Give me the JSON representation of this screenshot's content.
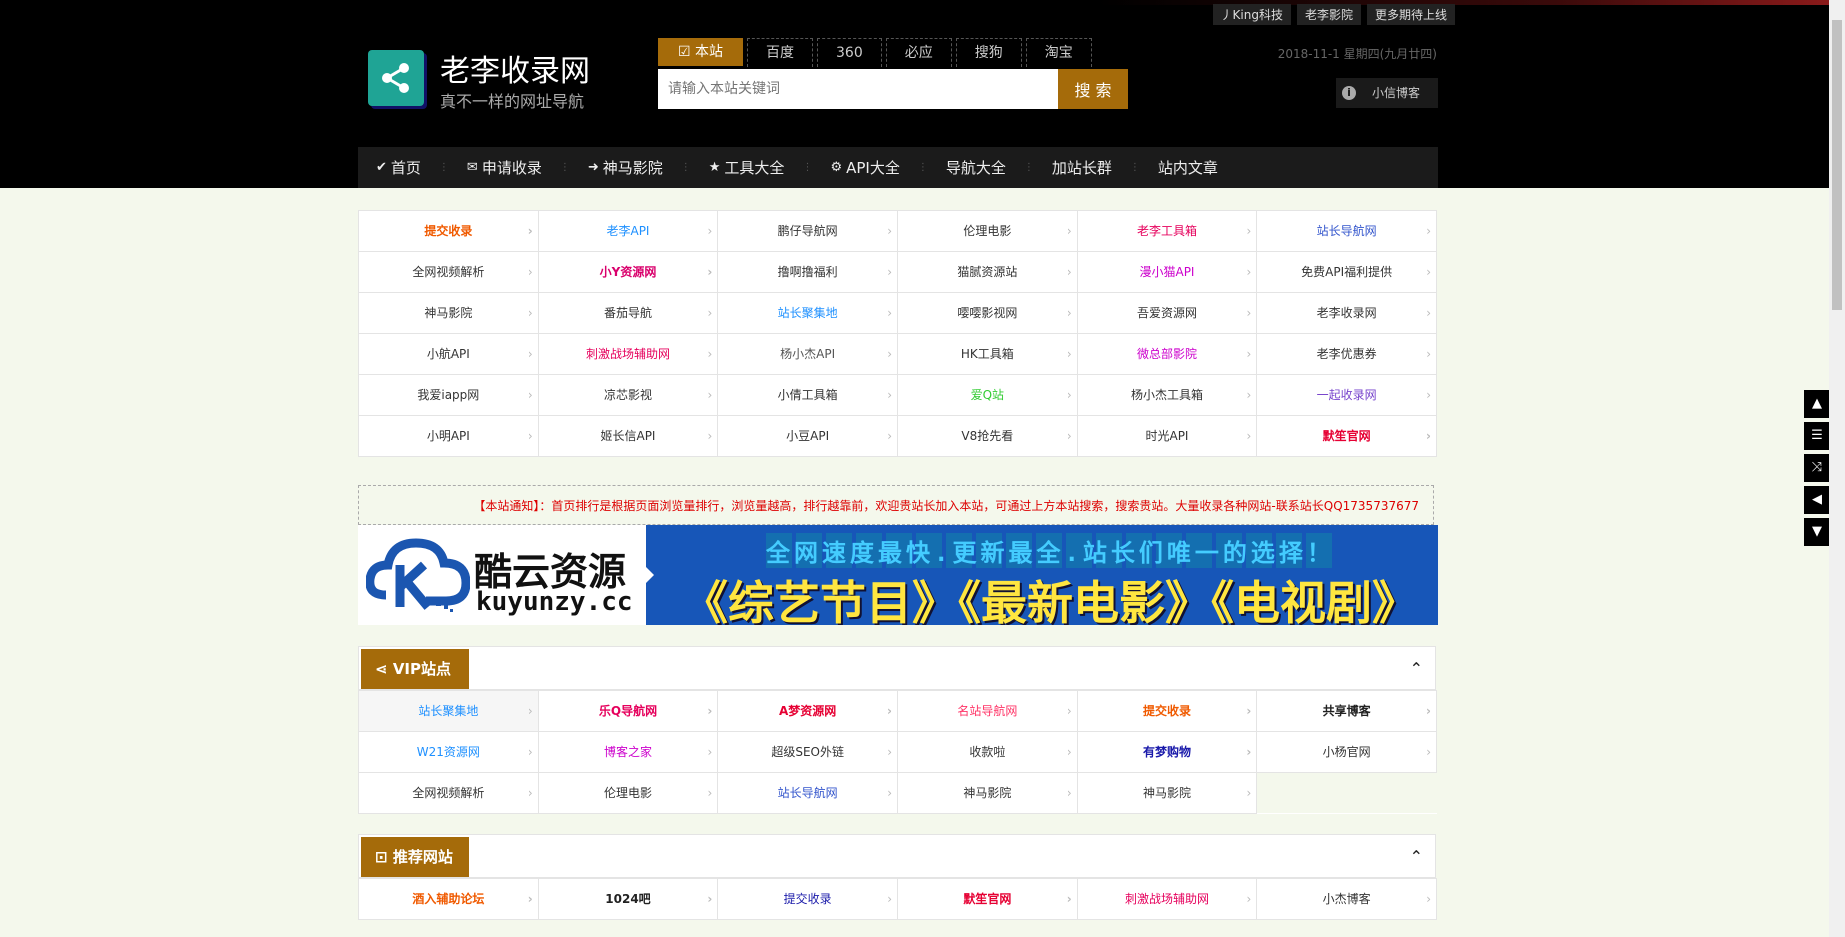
{
  "toplinks": [
    "丿King科技",
    "老李影院",
    "更多期待上线"
  ],
  "site": {
    "title": "老李收录网",
    "subtitle": "真不一样的网址导航"
  },
  "search": {
    "tabs": [
      "本站",
      "百度",
      "360",
      "必应",
      "搜狗",
      "淘宝"
    ],
    "placeholder": "请输入本站关键词",
    "button": "搜 索"
  },
  "datetime": "2018-11-1 星期四(九月廿四)",
  "user": {
    "label": "小信博客"
  },
  "nav": [
    {
      "label": "首页",
      "icon": "check-circle-icon"
    },
    {
      "label": "申请收录",
      "icon": "envelope-icon"
    },
    {
      "label": "神马影院",
      "icon": "chevron-circle-icon"
    },
    {
      "label": "工具大全",
      "icon": "star-icon"
    },
    {
      "label": "API大全",
      "icon": "gear-icon"
    },
    {
      "label": "导航大全",
      "icon": ""
    },
    {
      "label": "加站长群",
      "icon": ""
    },
    {
      "label": "站内文章",
      "icon": ""
    }
  ],
  "links_grid": [
    {
      "label": "提交收录",
      "color": "#f05a00",
      "bold": true
    },
    {
      "label": "老李API",
      "color": "#1e90ff"
    },
    {
      "label": "鹏仔导航网",
      "color": "#333"
    },
    {
      "label": "伦理电影",
      "color": "#333"
    },
    {
      "label": "老李工具箱",
      "color": "#e6005c"
    },
    {
      "label": "站长导航网",
      "color": "#3355cc"
    },
    {
      "label": "全网视频解析",
      "color": "#333"
    },
    {
      "label": "小Y资源网",
      "color": "#d9006c",
      "bold": true
    },
    {
      "label": "撸啊撸福利",
      "color": "#333"
    },
    {
      "label": "猫腻资源站",
      "color": "#333"
    },
    {
      "label": "漫小猫API",
      "color": "#cc00cc"
    },
    {
      "label": "免费API福利提供",
      "color": "#333"
    },
    {
      "label": "神马影院",
      "color": "#333"
    },
    {
      "label": "番茄导航",
      "color": "#333"
    },
    {
      "label": "站长聚集地",
      "color": "#1e90ff"
    },
    {
      "label": "嘤嘤影视网",
      "color": "#333"
    },
    {
      "label": "吾爱资源网",
      "color": "#333"
    },
    {
      "label": "老李收录网",
      "color": "#333"
    },
    {
      "label": "小航API",
      "color": "#333"
    },
    {
      "label": "刺激战场辅助网",
      "color": "#e6005c"
    },
    {
      "label": "杨小杰API",
      "color": "#555"
    },
    {
      "label": "HK工具箱",
      "color": "#333"
    },
    {
      "label": "微总部影院",
      "color": "#cc00cc"
    },
    {
      "label": "老李优惠券",
      "color": "#333"
    },
    {
      "label": "我爱iapp网",
      "color": "#333"
    },
    {
      "label": "凉芯影视",
      "color": "#333"
    },
    {
      "label": "小倩工具箱",
      "color": "#333"
    },
    {
      "label": "爱Q站",
      "color": "#33cc33"
    },
    {
      "label": "杨小杰工具箱",
      "color": "#333"
    },
    {
      "label": "一起收录网",
      "color": "#7744cc"
    },
    {
      "label": "小明API",
      "color": "#333"
    },
    {
      "label": "姬长信API",
      "color": "#333"
    },
    {
      "label": "小豆API",
      "color": "#333"
    },
    {
      "label": "V8抢先看",
      "color": "#333"
    },
    {
      "label": "时光API",
      "color": "#333"
    },
    {
      "label": "默笙官网",
      "color": "#e60033",
      "bold": true
    }
  ],
  "notice": "【本站通知】：首页排行是根据页面浏览量排行，浏览量越高，排行越靠前，欢迎贵站长加入本站，可通过上方本站搜索，搜索贵站。大量收录各种网站-联系站长QQ1735737677",
  "banner": {
    "brand_cn": "酷云资源",
    "brand_en": "kuyunzy.cc",
    "line1": "全网速度最快.更新最全.站长们唯一的选择！",
    "line2": "《综艺节目》《最新电影》《电视剧》"
  },
  "vip": {
    "title": "VIP站点",
    "items": [
      {
        "label": "站长聚集地",
        "color": "#1e90ff",
        "hl": true
      },
      {
        "label": "乐Q导航网",
        "color": "#e6005c",
        "bold": true
      },
      {
        "label": "A梦资源网",
        "color": "#e60033",
        "bold": true
      },
      {
        "label": "名站导航网",
        "color": "#ff3366"
      },
      {
        "label": "提交收录",
        "color": "#f05a00",
        "bold": true
      },
      {
        "label": "共享博客",
        "color": "#222",
        "bold": true
      },
      {
        "label": "W21资源网",
        "color": "#1e90ff"
      },
      {
        "label": "博客之家",
        "color": "#cc00cc"
      },
      {
        "label": "超级SEO外链",
        "color": "#333"
      },
      {
        "label": "收款啦",
        "color": "#333"
      },
      {
        "label": "有梦购物",
        "color": "#1a1aaa",
        "bold": true
      },
      {
        "label": "小杨官网",
        "color": "#333"
      },
      {
        "label": "全网视频解析",
        "color": "#333"
      },
      {
        "label": "伦理电影",
        "color": "#333"
      },
      {
        "label": "站长导航网",
        "color": "#3355cc"
      },
      {
        "label": "神马影院",
        "color": "#333"
      },
      {
        "label": "神马影院",
        "color": "#333"
      }
    ]
  },
  "recommend": {
    "title": "推荐网站",
    "items": [
      {
        "label": "酒入辅助论坛",
        "color": "#f05a00",
        "bold": true
      },
      {
        "label": "1024吧",
        "color": "#222",
        "bold": true
      },
      {
        "label": "提交收录",
        "color": "#1a1aaa"
      },
      {
        "label": "默笙官网",
        "color": "#e60033",
        "bold": true
      },
      {
        "label": "刺激战场辅助网",
        "color": "#e6005c"
      },
      {
        "label": "小杰博客",
        "color": "#333"
      }
    ]
  },
  "sidetools": [
    "arrow-up-icon",
    "list-icon",
    "shuffle-icon",
    "share-icon",
    "arrow-down-icon"
  ],
  "sidetool_glyphs": [
    "▲",
    "☰",
    "⤨",
    "◀",
    "▼"
  ]
}
